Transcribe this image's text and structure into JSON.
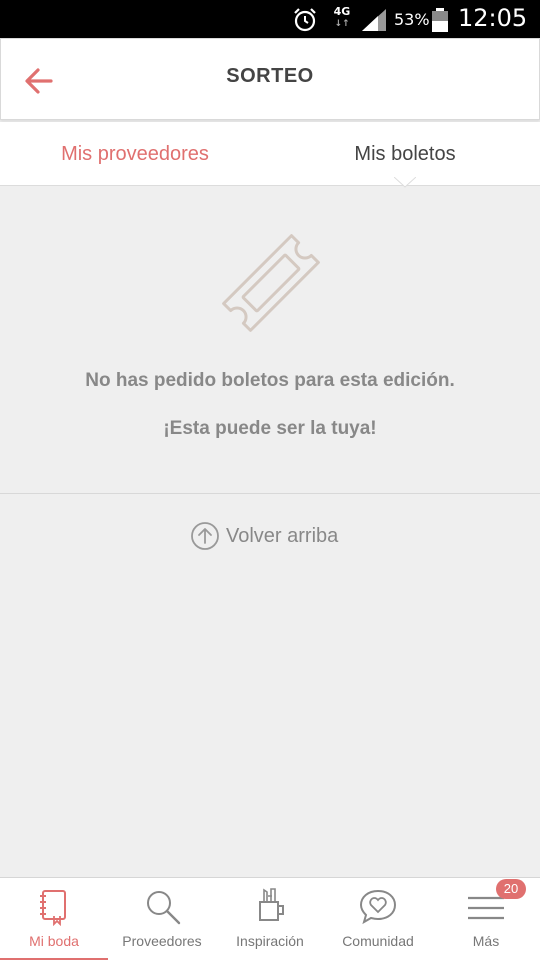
{
  "status_bar": {
    "network": "4G",
    "network_arrows": "↓↑",
    "battery_percent": "53%",
    "time": "12:05"
  },
  "header": {
    "title": "SORTEO"
  },
  "tabs": [
    {
      "label": "Mis proveedores",
      "selected": false
    },
    {
      "label": "Mis boletos",
      "selected": true
    }
  ],
  "empty_state": {
    "icon": "ticket-icon",
    "message": "No has pedido boletos para esta edición.",
    "sub_message": "¡Esta puede ser la tuya!"
  },
  "back_to_top": {
    "label": "Volver arriba",
    "icon": "arrow-up-circle-icon"
  },
  "bottom_nav": {
    "items": [
      {
        "label": "Mi boda",
        "icon": "notebook-icon",
        "active": true
      },
      {
        "label": "Proveedores",
        "icon": "search-icon",
        "active": false
      },
      {
        "label": "Inspiración",
        "icon": "tools-cup-icon",
        "active": false
      },
      {
        "label": "Comunidad",
        "icon": "chat-heart-icon",
        "active": false
      },
      {
        "label": "Más",
        "icon": "menu-icon",
        "active": false
      }
    ],
    "more_badge": "20"
  },
  "colors": {
    "accent": "#e0706f",
    "text_dark": "#444444",
    "text_muted": "#888888",
    "background": "#efefef",
    "icon_stroke": "#d4c9c1"
  }
}
